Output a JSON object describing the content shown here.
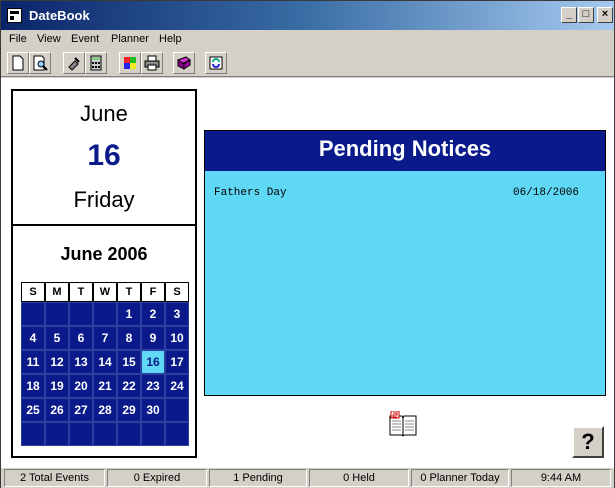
{
  "window": {
    "title": "DateBook"
  },
  "menu": [
    "File",
    "View",
    "Event",
    "Planner",
    "Help"
  ],
  "toolbar": {
    "buttons": [
      "new-icon",
      "preview-icon",
      "tools-icon",
      "calculator-icon",
      "palette-icon",
      "print-icon",
      "book-icon",
      "refresh-icon"
    ]
  },
  "date_panel": {
    "month": "June",
    "day": "16",
    "weekday": "Friday"
  },
  "calendar": {
    "title": "June 2006",
    "weekdays": [
      "S",
      "M",
      "T",
      "W",
      "T",
      "F",
      "S"
    ],
    "weeks": [
      [
        "",
        "",
        "",
        "",
        "1",
        "2",
        "3"
      ],
      [
        "4",
        "5",
        "6",
        "7",
        "8",
        "9",
        "10"
      ],
      [
        "11",
        "12",
        "13",
        "14",
        "15",
        "16",
        "17"
      ],
      [
        "18",
        "19",
        "20",
        "21",
        "22",
        "23",
        "24"
      ],
      [
        "25",
        "26",
        "27",
        "28",
        "29",
        "30",
        ""
      ],
      [
        "",
        "",
        "",
        "",
        "",
        "",
        ""
      ]
    ],
    "today": "16"
  },
  "notices": {
    "title": "Pending Notices",
    "items": [
      {
        "name": "Fathers Day",
        "date": "06/18/2006"
      }
    ]
  },
  "help_button": {
    "label": "?"
  },
  "status": [
    "2 Total Events",
    "0 Expired",
    "1 Pending",
    "0 Held",
    "0 Planner Today",
    "9:44 AM"
  ],
  "colors": {
    "navy": "#0a1a8a",
    "cyan": "#5fd8f5"
  }
}
